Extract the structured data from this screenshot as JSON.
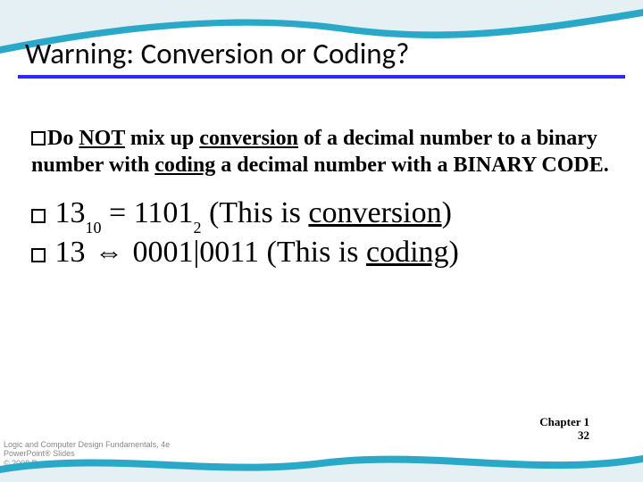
{
  "title": "Warning: Conversion or Coding?",
  "para": {
    "pre": "Do ",
    "not": "NOT",
    "mid1": " mix up ",
    "conv": "conversion",
    "mid2": " of a decimal number to a binary number with ",
    "coding": "coding",
    "mid3": " a decimal number with a BINARY CODE."
  },
  "line2": {
    "val": "13",
    "base1": "10",
    "eq": " = ",
    "bin": "1101",
    "base2": "2",
    "open": " (This is ",
    "word": "conversion",
    "close": ")"
  },
  "line3": {
    "val": " 13  ",
    "arrow": "⇔",
    "codes": " 0001|0011 (This is ",
    "word": "coding",
    "close": ")"
  },
  "footer": {
    "chapter": "Chapter 1",
    "page": "32"
  },
  "copyright": {
    "l1": "Logic and Computer Design Fundamentals, 4e",
    "l2": "PowerPoint® Slides",
    "l3": "© 2008 Pearson Education, Inc."
  }
}
